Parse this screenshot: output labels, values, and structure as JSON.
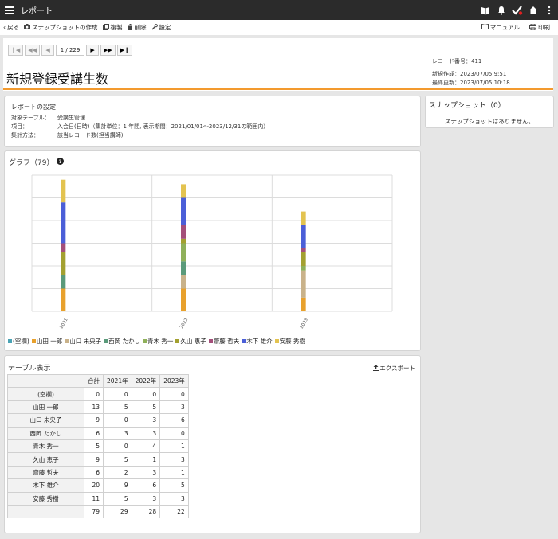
{
  "header": {
    "title": "レポート",
    "icons": [
      "book-icon",
      "bell-icon",
      "check-icon",
      "home-icon",
      "more-vertical-icon"
    ]
  },
  "toolbar": {
    "back": "戻る",
    "snapshot": "スナップショットの作成",
    "copy": "複製",
    "delete": "削除",
    "settings": "設定",
    "manual": "マニュアル",
    "print": "印刷"
  },
  "pager": {
    "position": "1 / 229"
  },
  "record": {
    "title": "新規登録受講生数",
    "number": "レコード番号：411",
    "created": "新規作成：2023/07/05 9:51",
    "updated": "最終更新：2023/07/05 10:18"
  },
  "report_settings": {
    "heading": "レポートの設定",
    "rows": [
      {
        "key": "対象テーブル：",
        "value": "受講生管理"
      },
      {
        "key": "項目：",
        "value": "入会日(日時)（集計単位：1 年間, 表示期間：2021/01/01〜2023/12/31の範囲内）"
      },
      {
        "key": "集計方法：",
        "value": "該当レコード数(担当講師)"
      }
    ]
  },
  "snapshot": {
    "heading": "スナップショット（0）",
    "empty": "スナップショットはありません。"
  },
  "graph": {
    "heading": "グラフ（79）",
    "help_icon": "question-circle-icon"
  },
  "chart_data": {
    "type": "bar",
    "stacked": true,
    "categories": [
      "2021",
      "2022",
      "2023"
    ],
    "series": [
      {
        "name": "(空欄)",
        "color": "#4aa3b5",
        "values": [
          0,
          0,
          0
        ]
      },
      {
        "name": "山田 一郎",
        "color": "#e8a12d",
        "values": [
          5,
          5,
          3
        ]
      },
      {
        "name": "山口 未央子",
        "color": "#c9b28a",
        "values": [
          0,
          3,
          6
        ]
      },
      {
        "name": "西岡 たかし",
        "color": "#5a9a7a",
        "values": [
          3,
          3,
          0
        ]
      },
      {
        "name": "青木 秀一",
        "color": "#8fb05a",
        "values": [
          0,
          4,
          1
        ]
      },
      {
        "name": "久山 恵子",
        "color": "#a3a030",
        "values": [
          5,
          1,
          3
        ]
      },
      {
        "name": "齋藤 哲夫",
        "color": "#a44f7a",
        "values": [
          2,
          3,
          1
        ]
      },
      {
        "name": "木下 雄介",
        "color": "#4b5fd8",
        "values": [
          9,
          6,
          5
        ]
      },
      {
        "name": "安藤 秀樹",
        "color": "#e3c350",
        "values": [
          5,
          3,
          3
        ]
      }
    ],
    "ylim": [
      0,
      30
    ],
    "grid": true,
    "legend": "bottom-left"
  },
  "table": {
    "heading": "テーブル表示",
    "export": "エクスポート",
    "columns": [
      "合計",
      "2021年",
      "2022年",
      "2023年"
    ],
    "rows": [
      {
        "name": "(空欄)",
        "cells": [
          "0",
          "0",
          "0",
          "0"
        ]
      },
      {
        "name": "山田 一郎",
        "cells": [
          "13",
          "5",
          "5",
          "3"
        ]
      },
      {
        "name": "山口 未央子",
        "cells": [
          "9",
          "0",
          "3",
          "6"
        ]
      },
      {
        "name": "西岡 たかし",
        "cells": [
          "6",
          "3",
          "3",
          "0"
        ]
      },
      {
        "name": "青木 秀一",
        "cells": [
          "5",
          "0",
          "4",
          "1"
        ]
      },
      {
        "name": "久山 恵子",
        "cells": [
          "9",
          "5",
          "1",
          "3"
        ]
      },
      {
        "name": "齋藤 哲夫",
        "cells": [
          "6",
          "2",
          "3",
          "1"
        ]
      },
      {
        "name": "木下 雄介",
        "cells": [
          "20",
          "9",
          "6",
          "5"
        ]
      },
      {
        "name": "安藤 秀樹",
        "cells": [
          "11",
          "5",
          "3",
          "3"
        ]
      },
      {
        "name": "",
        "cells": [
          "79",
          "29",
          "28",
          "22"
        ]
      }
    ]
  }
}
